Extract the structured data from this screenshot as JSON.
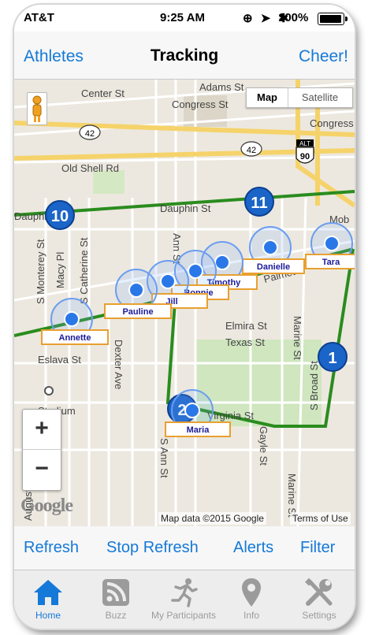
{
  "status_bar": {
    "carrier": "AT&T",
    "time": "9:25 AM",
    "battery": "100%"
  },
  "nav": {
    "left": "Athletes",
    "title": "Tracking",
    "right": "Cheer!"
  },
  "map": {
    "toggle": {
      "map": "Map",
      "satellite": "Satellite"
    },
    "zoom_in": "+",
    "zoom_out": "−",
    "google_logo": "Google",
    "attribution": "Map data ©2015 Google",
    "terms": "Terms of Use",
    "streets": [
      "Center St",
      "Adams St",
      "Congress St",
      "Congress S",
      "Old Shell Rd",
      "Dauphin St",
      "Dauphin St",
      "Mob",
      "S Monterey St",
      "Macy Pl",
      "S Catherine St",
      "Dexter Ave",
      "Ann St",
      "Palmetto",
      "Elmira St",
      "Texas St",
      "Marine St",
      "Eslava St",
      "Stadium",
      "Virginia St",
      "S Broad St",
      "S Ann St",
      "Gayle St",
      "Marine St",
      "Augusta"
    ],
    "route_shields": [
      "42",
      "42",
      "ALT",
      "90"
    ],
    "mile_markers": [
      "10",
      "11",
      "1",
      "2"
    ],
    "athletes": [
      "Tara",
      "Danielle",
      "Timothy",
      "Bonnie",
      "Jill",
      "Pauline",
      "Annette",
      "Maria"
    ]
  },
  "actions": {
    "refresh": "Refresh",
    "stop_refresh": "Stop Refresh",
    "alerts": "Alerts",
    "filter": "Filter"
  },
  "tabs": [
    {
      "label": "Home",
      "icon": "home-icon",
      "active": true
    },
    {
      "label": "Buzz",
      "icon": "rss-icon",
      "active": false
    },
    {
      "label": "My Participants",
      "icon": "runner-icon",
      "active": false
    },
    {
      "label": "Info",
      "icon": "map-pin-icon",
      "active": false
    },
    {
      "label": "Settings",
      "icon": "tools-icon",
      "active": false
    }
  ],
  "colors": {
    "accent": "#1479d8",
    "route": "#2a8c1e",
    "marker": "#1b64c8",
    "label_border": "#e8a030"
  }
}
